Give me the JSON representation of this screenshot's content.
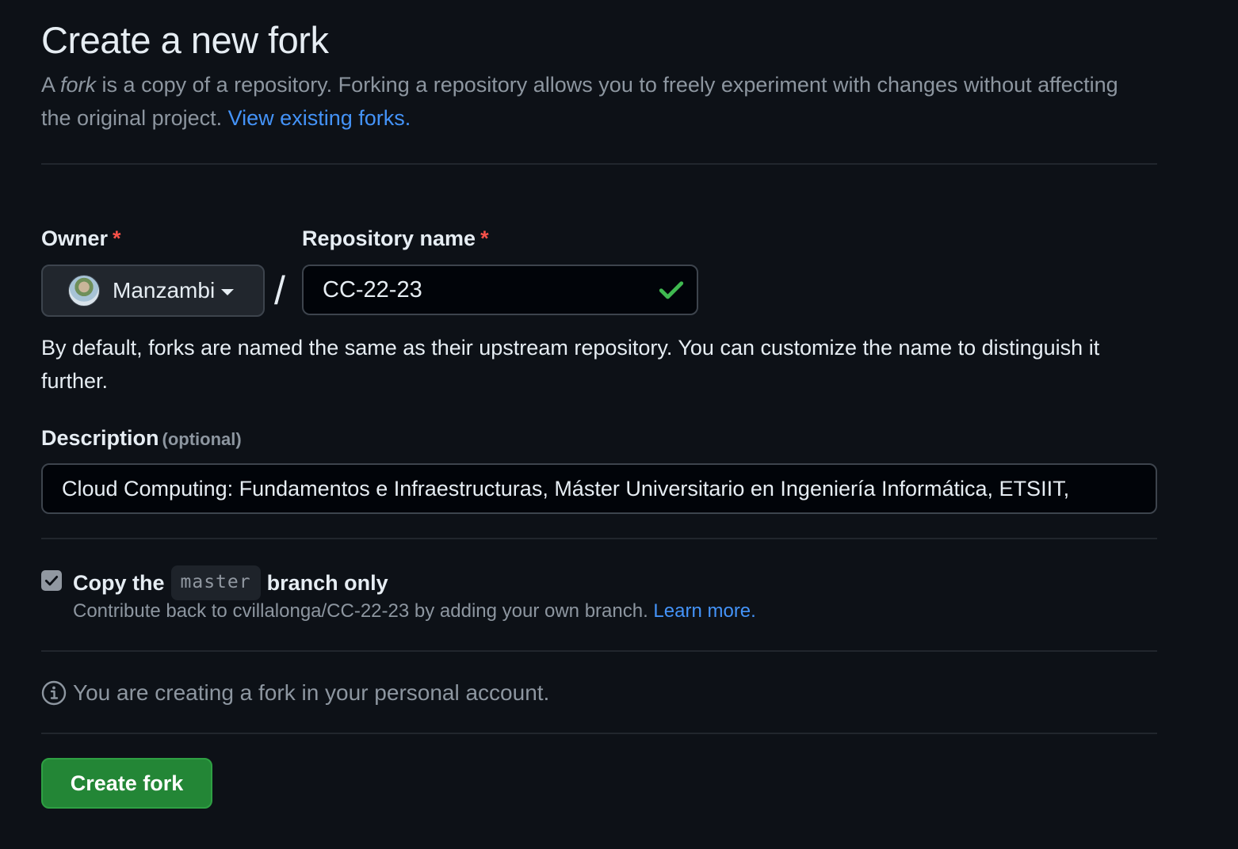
{
  "header": {
    "title": "Create a new fork",
    "intro_prefix": "A ",
    "intro_em": "fork",
    "intro_rest": " is a copy of a repository. Forking a repository allows you to freely experiment with changes without affecting the original project. ",
    "intro_link": "View existing forks."
  },
  "owner": {
    "label": "Owner",
    "required_mark": "*",
    "selected": "Manzambi"
  },
  "separator": "/",
  "repository": {
    "label": "Repository name",
    "required_mark": "*",
    "value": "CC-22-23",
    "status": "valid",
    "help": "By default, forks are named the same as their upstream repository. You can customize the name to distinguish it further."
  },
  "description": {
    "label": "Description",
    "optional_label": "(optional)",
    "value": "Cloud Computing: Fundamentos e Infraestructuras, Máster Universitario en Ingeniería Informática, ETSIIT,"
  },
  "copy_branch": {
    "checked": true,
    "label_prefix": "Copy the",
    "branch": "master",
    "label_suffix": "branch only",
    "sub_text": "Contribute back to cvillalonga/CC-22-23 by adding your own branch.",
    "sub_link": "Learn more."
  },
  "info": {
    "icon": "info-icon",
    "text": "You are creating a fork in your personal account."
  },
  "actions": {
    "create_label": "Create fork"
  },
  "colors": {
    "background": "#0d1117",
    "link": "#4493f8",
    "required": "#f85149",
    "success": "#3fb950",
    "primary_button": "#238636"
  }
}
